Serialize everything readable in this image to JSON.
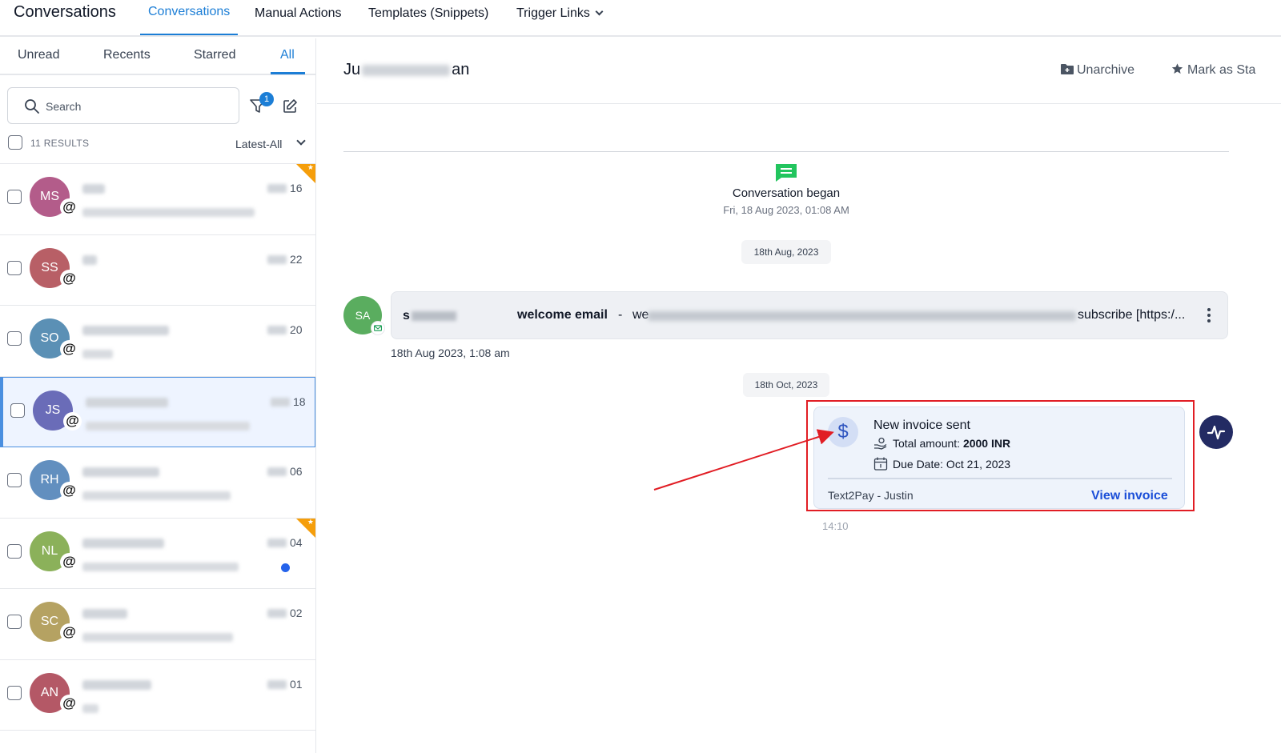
{
  "topnav": {
    "app_title": "Conversations",
    "tabs": [
      {
        "label": "Conversations"
      },
      {
        "label": "Manual Actions"
      },
      {
        "label": "Templates (Snippets)"
      },
      {
        "label": "Trigger Links"
      }
    ]
  },
  "sidebar": {
    "tabs": [
      {
        "label": "Unread"
      },
      {
        "label": "Recents"
      },
      {
        "label": "Starred"
      },
      {
        "label": "All"
      }
    ],
    "search_placeholder": "Search",
    "filter_badge": "1",
    "results_label": "11 RESULTS",
    "sort_label": "Latest-All",
    "conversations": [
      {
        "initials": "MS",
        "color": "#b35c8a",
        "date": "16",
        "starred": true,
        "unread": false
      },
      {
        "initials": "SS",
        "color": "#b85f66",
        "date": "22",
        "starred": false,
        "unread": false
      },
      {
        "initials": "SO",
        "color": "#5b90b5",
        "date": "20",
        "starred": false,
        "unread": false
      },
      {
        "initials": "JS",
        "color": "#6a6cb8",
        "date": "18",
        "starred": false,
        "unread": false,
        "selected": true
      },
      {
        "initials": "RH",
        "color": "#628fbf",
        "date": "06",
        "starred": false,
        "unread": false
      },
      {
        "initials": "NL",
        "color": "#8bb15a",
        "date": "04",
        "starred": true,
        "unread": true
      },
      {
        "initials": "SC",
        "color": "#b5a262",
        "date": "02",
        "starred": false,
        "unread": false
      },
      {
        "initials": "AN",
        "color": "#b45866",
        "date": "01",
        "starred": false,
        "unread": false
      }
    ]
  },
  "header": {
    "contact_name_start": "Ju",
    "contact_name_end": "an",
    "unarchive_label": "Unarchive",
    "mark_star_label": "Mark as Sta"
  },
  "thread": {
    "began_title": "Conversation began",
    "began_time": "Fri, 18 Aug 2023, 01:08 AM",
    "date_pill_1": "18th Aug, 2023",
    "date_pill_2": "18th Oct, 2023",
    "email": {
      "avatar_initials": "SA",
      "from_start": "s",
      "subject": "welcome email",
      "separator": "-",
      "preview_start": "we",
      "preview_end": "subscribe [https:/...",
      "time": "18th Aug 2023, 1:08 am"
    },
    "invoice": {
      "icon": "$",
      "title": "New invoice sent",
      "amount_label": "Total amount:",
      "amount_value": "2000 INR",
      "due_label": "Due Date: Oct 21, 2023",
      "footer_left": "Text2Pay - Justin",
      "view_label": "View invoice",
      "time": "14:10"
    }
  },
  "colors": {
    "accent": "#1c7ed6",
    "highlight": "#e11d24",
    "activity_button": "#232b63",
    "chat_icon": "#22c55e"
  }
}
